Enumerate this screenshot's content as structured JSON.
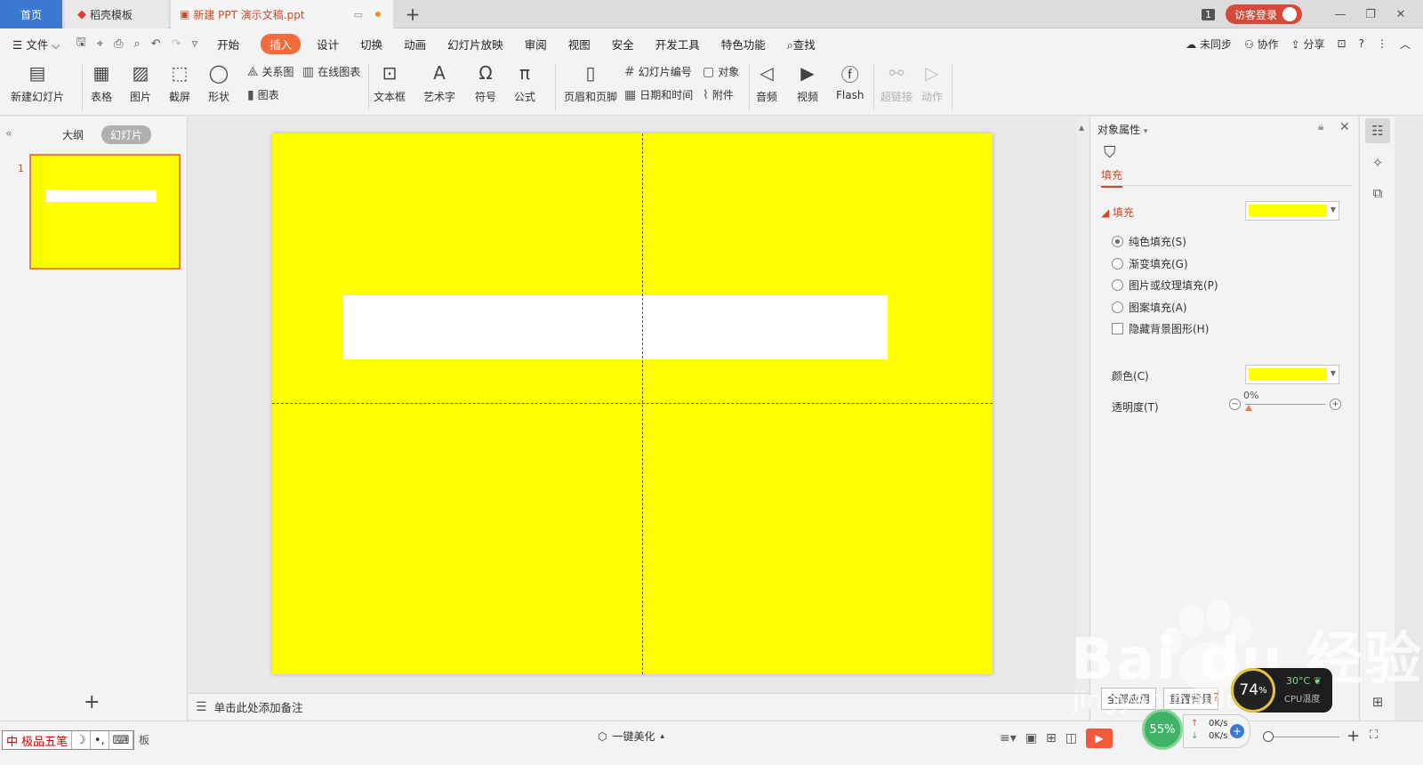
{
  "tabs": {
    "home": "首页",
    "template": "稻壳模板",
    "doc": "新建 PPT 演示文稿.ppt",
    "add": "+"
  },
  "titlebar": {
    "count": "1",
    "login": "访客登录"
  },
  "menu": {
    "file": "文件",
    "items": [
      "开始",
      "插入",
      "设计",
      "切换",
      "动画",
      "幻灯片放映",
      "审阅",
      "视图",
      "安全",
      "开发工具",
      "特色功能"
    ],
    "search": "查找",
    "right": [
      "未同步",
      "协作",
      "分享"
    ]
  },
  "ribbon": {
    "new_slide": "新建幻灯片",
    "table": "表格",
    "picture": "图片",
    "screenshot": "截屏",
    "shape": "形状",
    "relation": "关系图",
    "online_chart": "在线图表",
    "chart": "图表",
    "textbox": "文本框",
    "wordart": "艺术字",
    "symbol": "符号",
    "formula": "公式",
    "header_footer": "页眉和页脚",
    "slide_number": "幻灯片编号",
    "object": "对象",
    "datetime": "日期和时间",
    "attachment": "附件",
    "audio": "音频",
    "video": "视频",
    "flash": "Flash",
    "hyperlink": "超链接",
    "action": "动作"
  },
  "left_panel": {
    "tab_outline": "大纲",
    "tab_slides": "幻灯片",
    "slide_number": "1",
    "add": "+"
  },
  "notes": {
    "placeholder": "单击此处添加备注"
  },
  "props": {
    "title": "对象属性",
    "fill_tab": "填充",
    "section": "填充",
    "options": [
      "纯色填充(S)",
      "渐变填充(G)",
      "图片或纹理填充(P)",
      "图案填充(A)"
    ],
    "selected_option": "纯色填充(S)",
    "hide_bg": "隐藏背景图形(H)",
    "color_label": "颜色(C)",
    "transparency_label": "透明度(T)",
    "transparency_value": "0%",
    "fill_color": "#ffff00",
    "apply_all": "全部应用",
    "reset_bg": "重置背景"
  },
  "slide": {
    "background": "#ffff00",
    "rect_fill": "#ffffff"
  },
  "statusbar": {
    "ime_brand": "极品五笔",
    "ime_tail": "板",
    "beautify": "一键美化",
    "mem_gauge": "55%",
    "net_up": "0K/s",
    "net_down": "0K/s",
    "cpu_usage": "74",
    "cpu_pct": "%",
    "cpu_temp": "30°C",
    "cpu_label": "CPU温度"
  },
  "watermark": {
    "text": "Bai du 经验",
    "url": "jingyan.baidu.com"
  },
  "colors": {
    "accent": "#f26b3a",
    "home_tab": "#3b79d1",
    "login": "#d6493a"
  }
}
